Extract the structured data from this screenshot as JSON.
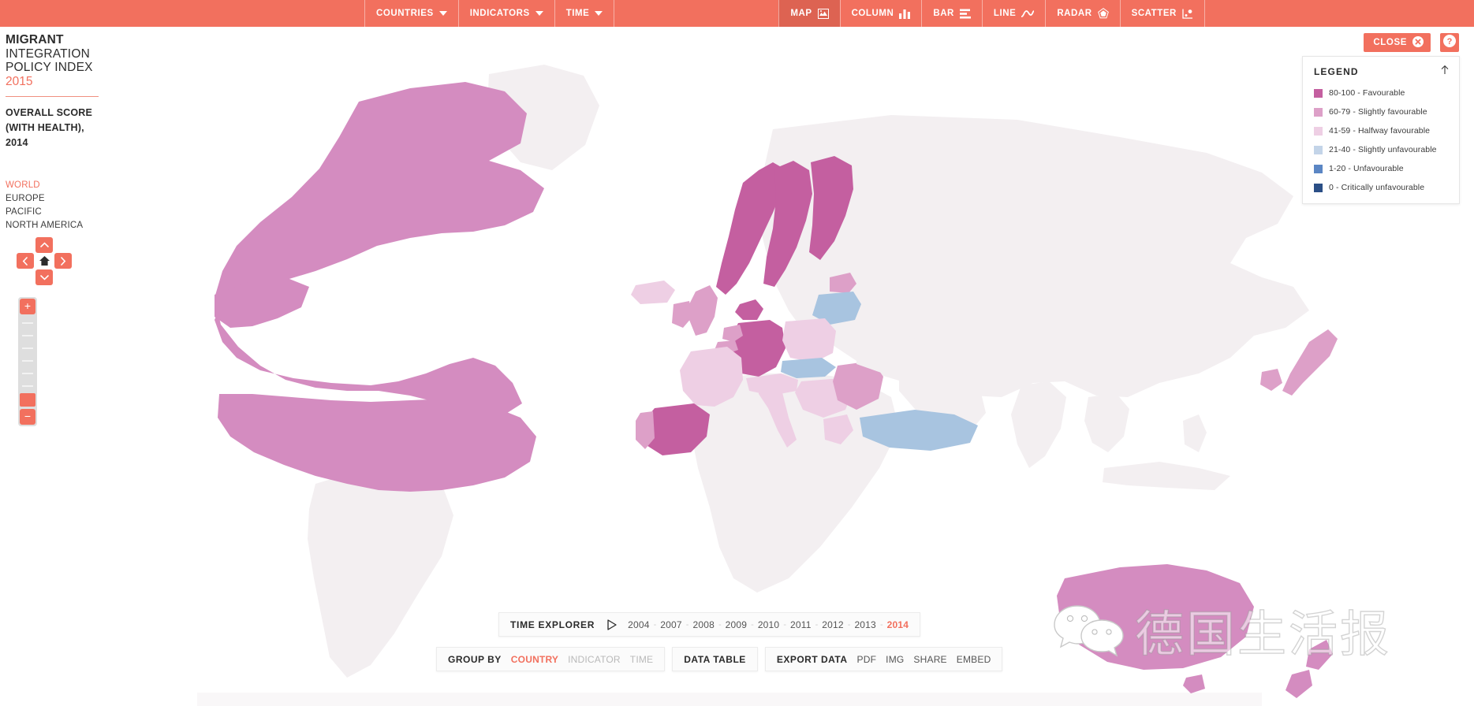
{
  "topbar": {
    "left_menus": [
      {
        "label": "COUNTRIES",
        "icon": "chevron-down-icon"
      },
      {
        "label": "INDICATORS",
        "icon": "chevron-down-icon"
      },
      {
        "label": "TIME",
        "icon": "chevron-down-icon"
      }
    ],
    "view_buttons": [
      {
        "label": "MAP",
        "icon": "map-icon",
        "active": true
      },
      {
        "label": "COLUMN",
        "icon": "column-chart-icon",
        "active": false
      },
      {
        "label": "BAR",
        "icon": "bar-chart-icon",
        "active": false
      },
      {
        "label": "LINE",
        "icon": "line-chart-icon",
        "active": false
      },
      {
        "label": "RADAR",
        "icon": "radar-chart-icon",
        "active": false
      },
      {
        "label": "SCATTER",
        "icon": "scatter-chart-icon",
        "active": false
      }
    ],
    "background_color": "#f2705e",
    "active_background_color": "#dd6352"
  },
  "title_panel": {
    "line1": "MIGRANT",
    "line2": "INTEGRATION",
    "line3": "POLICY INDEX",
    "year": "2015",
    "indicator_line1": "OVERALL SCORE",
    "indicator_line2": "(WITH HEALTH),",
    "indicator_line3": "2014",
    "regions": [
      {
        "label": "WORLD",
        "active": true
      },
      {
        "label": "EUROPE",
        "active": false
      },
      {
        "label": "PACIFIC",
        "active": false
      },
      {
        "label": "NORTH AMERICA",
        "active": false
      }
    ]
  },
  "map_nav": {
    "up": "pan-up-icon",
    "down": "pan-down-icon",
    "left": "pan-left-icon",
    "right": "pan-right-icon",
    "home": "home-icon",
    "zoom_in": "+",
    "zoom_out": "−"
  },
  "window_controls": {
    "close_label": "CLOSE",
    "close_icon": "close-circle-icon",
    "help_icon": "help-circle-icon"
  },
  "legend": {
    "title": "LEGEND",
    "collapse_icon": "arrow-up-icon",
    "items": [
      {
        "label": "80-100 - Favourable",
        "color": "#c45fa0"
      },
      {
        "label": "60-79 - Slightly favourable",
        "color": "#dda0c8"
      },
      {
        "label": "41-59 - Halfway favourable",
        "color": "#eecfe4"
      },
      {
        "label": "21-40 - Slightly unfavourable",
        "color": "#c3d4e8"
      },
      {
        "label": "1-20 - Unfavourable",
        "color": "#5b86c4"
      },
      {
        "label": "0 - Critically unfavourable",
        "color": "#2b4f86"
      }
    ]
  },
  "time_explorer": {
    "label": "TIME EXPLORER",
    "play_icon": "play-icon",
    "years": [
      "2004",
      "2007",
      "2008",
      "2009",
      "2010",
      "2011",
      "2012",
      "2013",
      "2014"
    ],
    "selected_year": "2014"
  },
  "bottom_toolbar": {
    "group_by_label": "GROUP BY",
    "group_by_options": [
      {
        "label": "COUNTRY",
        "active": true,
        "disabled": false
      },
      {
        "label": "INDICATOR",
        "active": false,
        "disabled": true
      },
      {
        "label": "TIME",
        "active": false,
        "disabled": true
      }
    ],
    "data_table_label": "DATA TABLE",
    "export_label": "EXPORT DATA",
    "export_options": [
      "PDF",
      "IMG",
      "SHARE",
      "EMBED"
    ]
  },
  "watermark": {
    "text": "德国生活报",
    "icon": "wechat-icon"
  },
  "map": {
    "ocean_color": "#ffffff",
    "no_data_color": "#f3eff1",
    "country_colors": {
      "favourable": "#d48cc0",
      "high_favourable": "#c45fa0",
      "slightly_favourable": "#dda0c8",
      "halfway": "#eecfe4",
      "slightly_unfavourable": "#a8c4e0",
      "unfavourable": "#5b86c4"
    }
  }
}
